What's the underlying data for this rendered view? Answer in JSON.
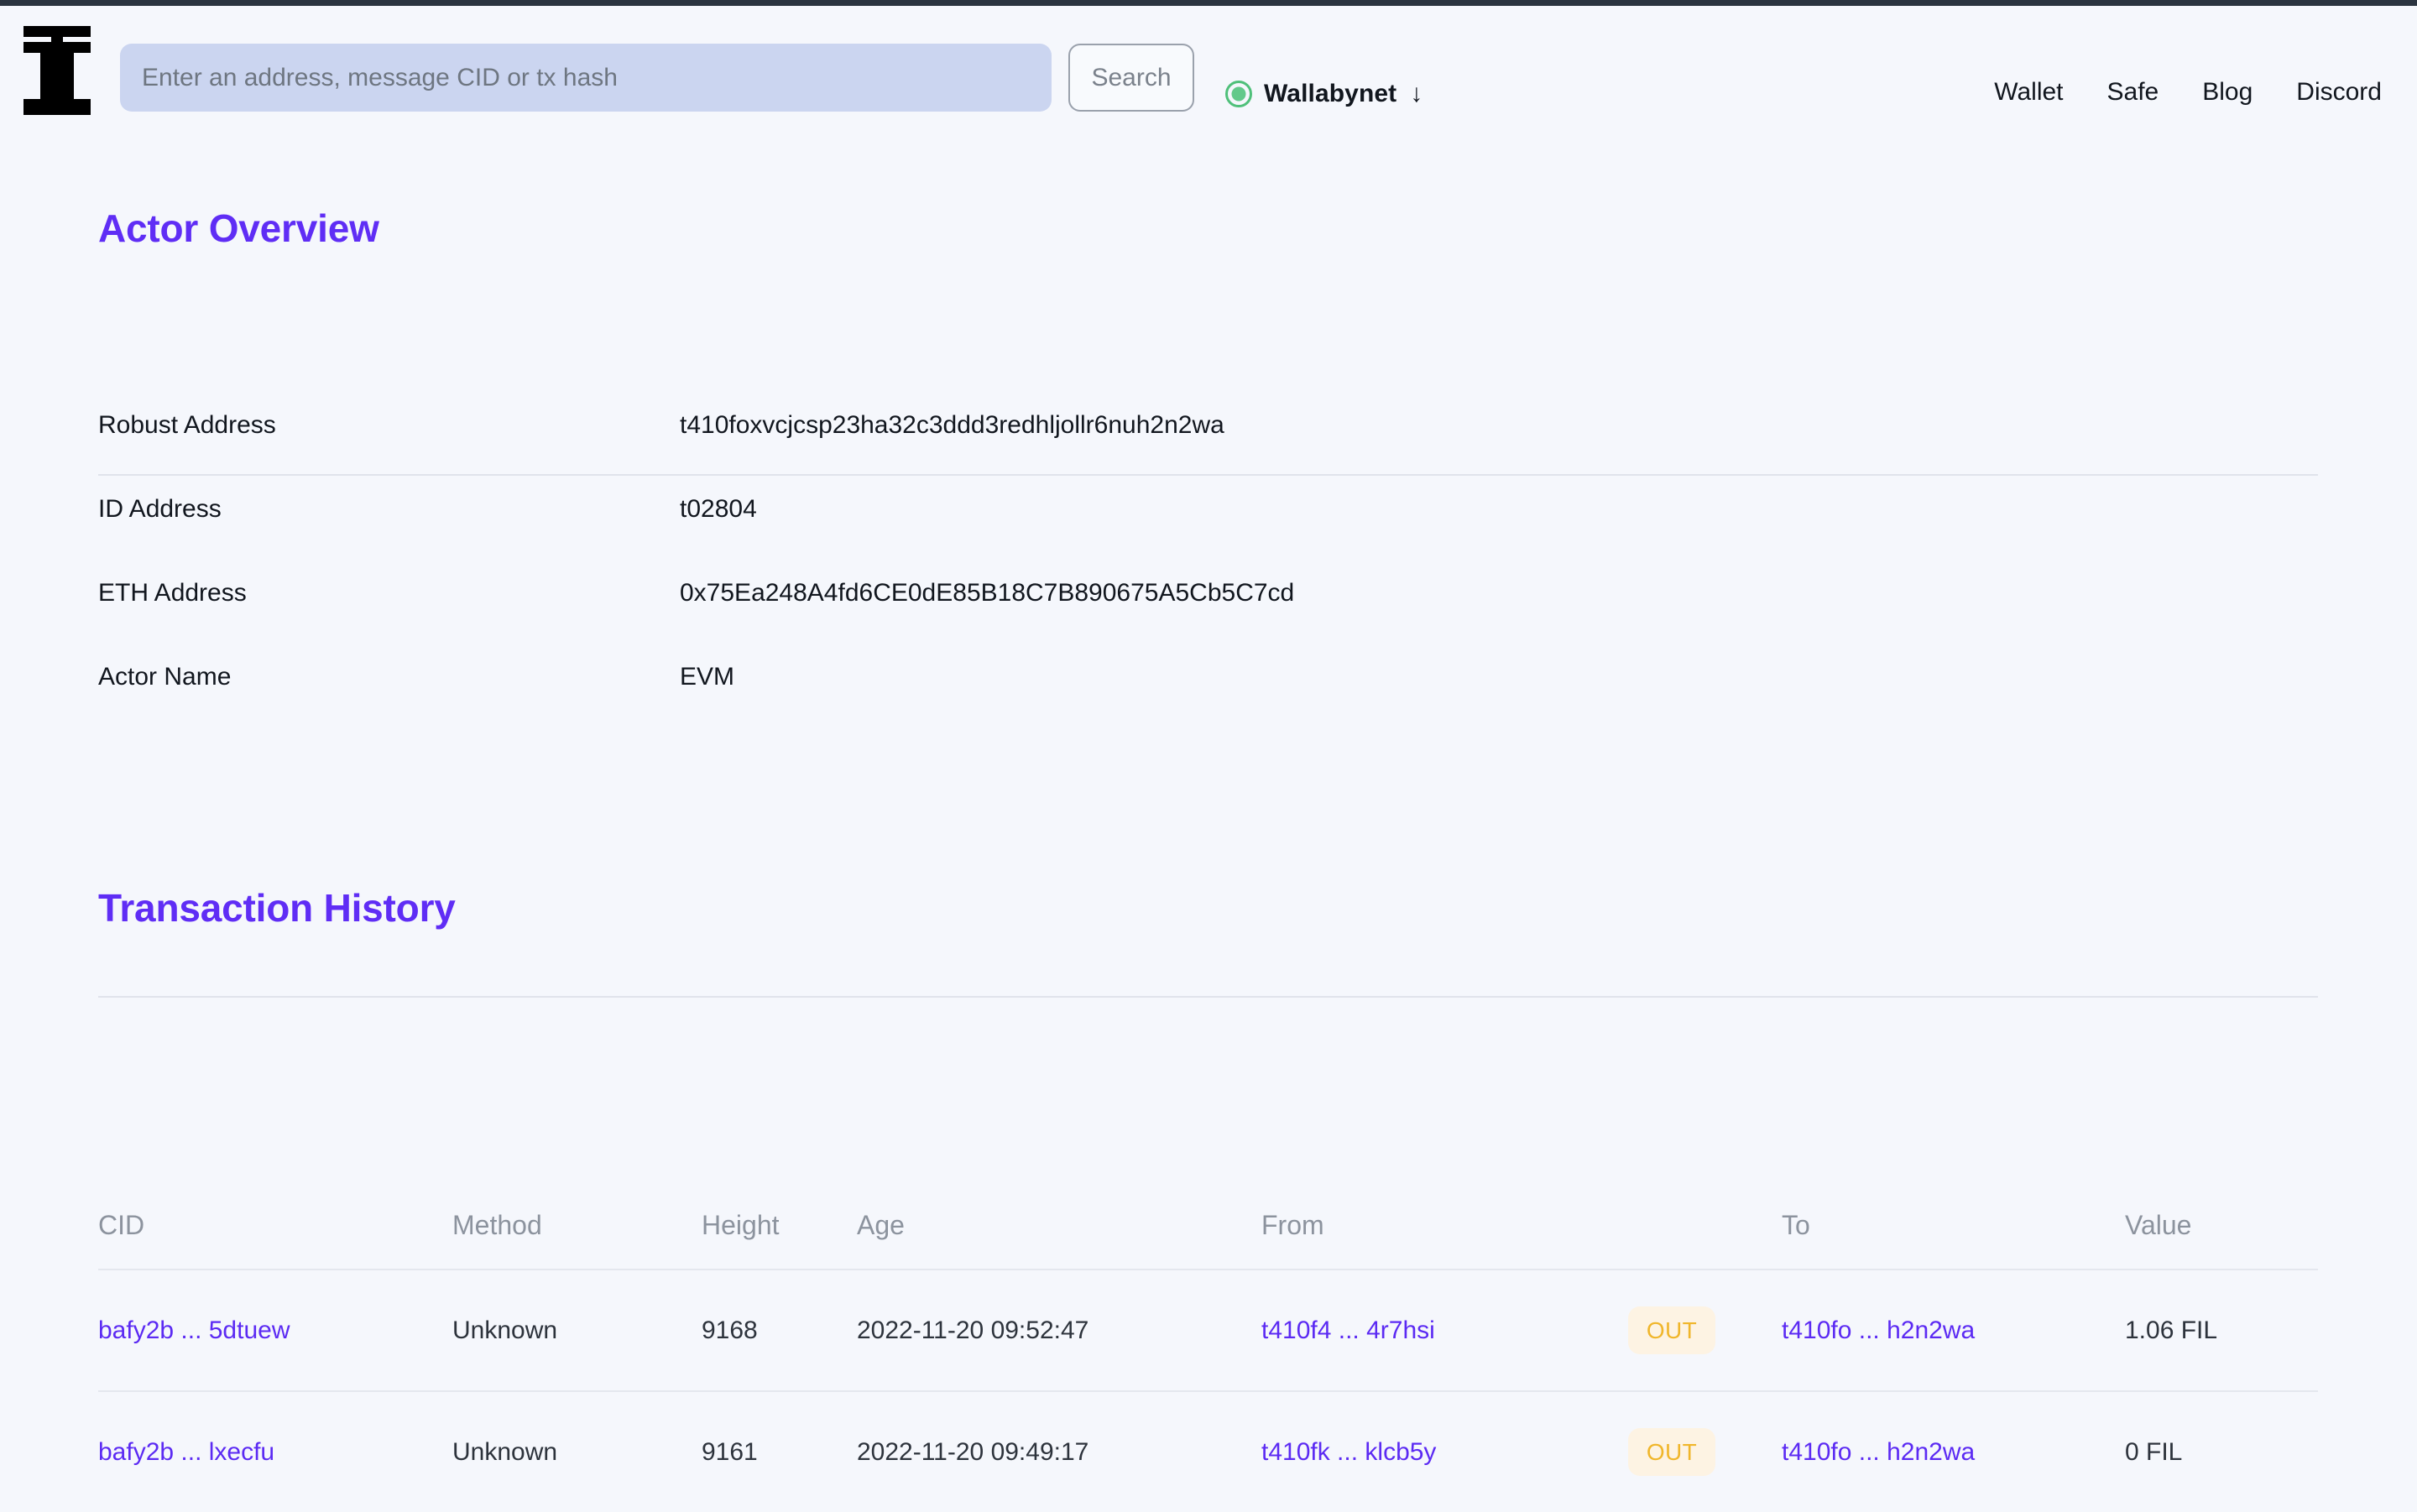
{
  "header": {
    "logo_icon": "beryx-logo-icon",
    "search": {
      "placeholder": "Enter an address, message CID or tx hash",
      "value": "",
      "button_label": "Search"
    },
    "network": {
      "name": "Wallabynet",
      "status_color": "#62C98A",
      "caret": "↓"
    },
    "nav": [
      {
        "label": "Wallet"
      },
      {
        "label": "Safe"
      },
      {
        "label": "Blog"
      },
      {
        "label": "Discord"
      }
    ]
  },
  "actor_overview": {
    "title": "Actor Overview",
    "rows": [
      {
        "label": "Robust Address",
        "value": "t410foxvcjcsp23ha32c3ddd3redhljollr6nuh2n2wa"
      },
      {
        "label": "ID Address",
        "value": "t02804"
      },
      {
        "label": "ETH Address",
        "value": "0x75Ea248A4fd6CE0dE85B18C7B890675A5Cb5C7cd"
      },
      {
        "label": "Actor Name",
        "value": "EVM"
      }
    ]
  },
  "transaction_history": {
    "title": "Transaction History",
    "columns": {
      "cid": "CID",
      "method": "Method",
      "height": "Height",
      "age": "Age",
      "from": "From",
      "to": "To",
      "value": "Value"
    },
    "rows": [
      {
        "cid": "bafy2b ... 5dtuew",
        "method": "Unknown",
        "height": "9168",
        "age": "2022-11-20 09:52:47",
        "from": "t410f4 ... 4r7hsi",
        "direction": "OUT",
        "to": "t410fo ... h2n2wa",
        "value": "1.06 FIL"
      },
      {
        "cid": "bafy2b ... lxecfu",
        "method": "Unknown",
        "height": "9161",
        "age": "2022-11-20 09:49:17",
        "from": "t410fk ... klcb5y",
        "direction": "OUT",
        "to": "t410fo ... h2n2wa",
        "value": "0 FIL"
      }
    ]
  },
  "theme": {
    "accent": "#5F2DF5",
    "background": "#F5F7FC",
    "badge_text": "#F0B62B",
    "badge_bg": "#FDF3E3",
    "search_bg": "#CBD5F0"
  }
}
